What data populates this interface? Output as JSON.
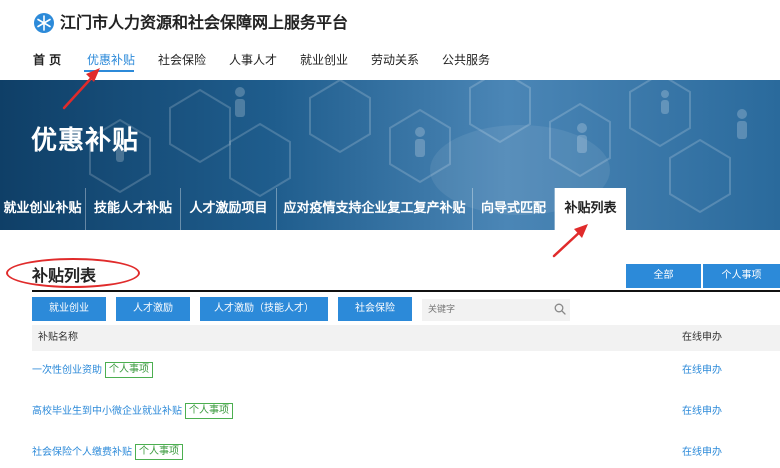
{
  "site": {
    "title": "江门市人力资源和社会保障网上服务平台"
  },
  "nav": {
    "items": [
      "首 页",
      "优惠补贴",
      "社会保险",
      "人事人才",
      "就业创业",
      "劳动关系",
      "公共服务"
    ]
  },
  "banner": {
    "title": "优惠补贴",
    "tabs": [
      "就业创业补贴",
      "技能人才补贴",
      "人才激励项目",
      "应对疫情支持企业复工复产补贴",
      "向导式匹配",
      "补贴列表"
    ]
  },
  "section": {
    "title": "补贴列表",
    "filters": [
      "全部",
      "个人事项"
    ]
  },
  "categories": [
    "就业创业",
    "人才激励",
    "人才激励（技能人才）",
    "社会保险"
  ],
  "search": {
    "placeholder": "关键字"
  },
  "table": {
    "headers": [
      "补贴名称",
      "在线申办"
    ],
    "rows": [
      {
        "name": "一次性创业资助",
        "badge": "个人事项",
        "action": "在线申办"
      },
      {
        "name": "高校毕业生到中小微企业就业补贴",
        "badge": "个人事项",
        "action": "在线申办"
      },
      {
        "name": "社会保险个人缴费补贴",
        "badge": "个人事项",
        "action": "在线申办"
      }
    ]
  },
  "colors": {
    "accent": "#2c8ad9",
    "annotation": "#e02b2b",
    "badge": "#4caf50"
  }
}
